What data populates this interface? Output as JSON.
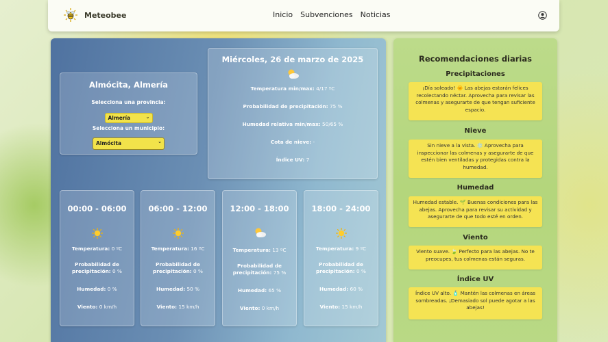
{
  "nav": {
    "brand": "Meteobee",
    "items": [
      "Inicio",
      "Subvenciones",
      "Noticias"
    ]
  },
  "location": {
    "title": "Almócita, Almería",
    "province_label": "Selecciona una provincia:",
    "province_value": "Almería",
    "municipality_label": "Selecciona un municipio:",
    "municipality_value": "Almócita"
  },
  "today": {
    "date": "Miércoles, 26 de marzo de 2025",
    "icon": "sun-cloud-icon",
    "rows": [
      {
        "label": "Temperatura min/max:",
        "value": "4/17 ºC"
      },
      {
        "label": "Probabilidad de precipitación:",
        "value": "75 %"
      },
      {
        "label": "Humedad relativa min/max:",
        "value": "50/65 %"
      },
      {
        "label": "Cota de nieve:",
        "value": "-"
      },
      {
        "label": "Índice UV:",
        "value": "7"
      }
    ]
  },
  "labels": {
    "temp": "Temperatura:",
    "precip_1": "Probabilidad de",
    "precip_2": "precipitación:",
    "humidity": "Humedad:",
    "wind": "Viento:"
  },
  "slots": [
    {
      "time": "00:00 - 06:00",
      "icon": "sun-icon",
      "temp": "0 ºC",
      "precip": "0 %",
      "humidity": "0 %",
      "wind": "0 km/h"
    },
    {
      "time": "06:00 - 12:00",
      "icon": "sun-icon",
      "temp": "16 ºC",
      "precip": "0 %",
      "humidity": "50 %",
      "wind": "15 km/h"
    },
    {
      "time": "12:00 - 18:00",
      "icon": "sun-cloud-icon",
      "temp": "13 ºC",
      "precip": "75 %",
      "humidity": "65 %",
      "wind": "0 km/h"
    },
    {
      "time": "18:00 - 24:00",
      "icon": "sun-icon",
      "temp": "9 ºC",
      "precip": "0 %",
      "humidity": "60 %",
      "wind": "15 km/h"
    }
  ],
  "recommendations": {
    "title": "Recomendaciones diarias",
    "sections": [
      {
        "heading": "Precipitaciones",
        "text": "¡Día soleado! 🌞 Las abejas estarán felices recolectando néctar. Aprovecha para revisar las colmenas y asegurarte de que tengan suficiente espacio."
      },
      {
        "heading": "Nieve",
        "text": "Sin nieve a la vista. ❄️ Aprovecha para inspeccionar las colmenas y asegurarte de que estén bien ventiladas y protegidas contra la humedad."
      },
      {
        "heading": "Humedad",
        "text": "Humedad estable. 🌱 Buenas condiciones para las abejas. Aprovecha para revisar su actividad y asegurarte de que todo esté en orden."
      },
      {
        "heading": "Viento",
        "text": "Viento suave. 🍃 Perfecto para las abejas. No te preocupes, tus colmenas están seguras."
      },
      {
        "heading": "Índice UV",
        "text": "Índice UV alto. 🧴 Mantén las colmenas en áreas sombreadas. ¡Demasiado sol puede agotar a las abejas!"
      }
    ]
  },
  "colors": {
    "accent": "#f2e34a",
    "left_panel": "#5b7ea9",
    "right_panel": "#b8d882"
  }
}
